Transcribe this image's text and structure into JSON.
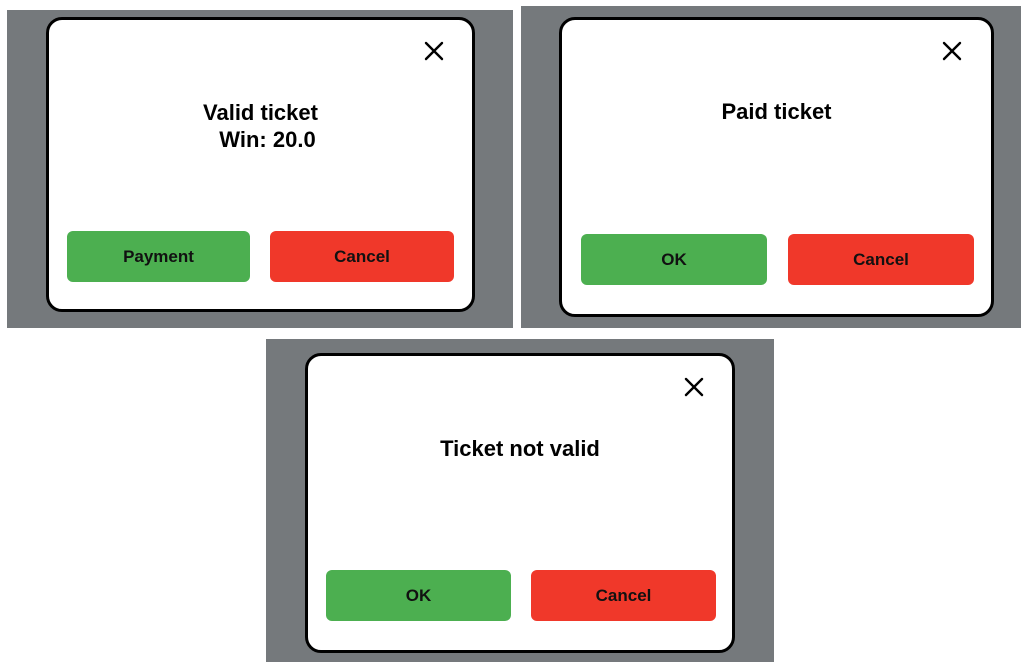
{
  "colors": {
    "backdrop": "#75797c",
    "dialog_background": "#ffffff",
    "dialog_border": "#000000",
    "confirm_button": "#4caf50",
    "cancel_button": "#f0382a"
  },
  "dialogs": [
    {
      "close_icon": "close-icon",
      "message_lines": [
        "Valid ticket",
        "Win: 20.0"
      ],
      "confirm_label": "Payment",
      "cancel_label": "Cancel"
    },
    {
      "close_icon": "close-icon",
      "message_lines": [
        "Paid ticket"
      ],
      "confirm_label": "OK",
      "cancel_label": "Cancel"
    },
    {
      "close_icon": "close-icon",
      "message_lines": [
        "Ticket not valid"
      ],
      "confirm_label": "OK",
      "cancel_label": "Cancel"
    }
  ]
}
